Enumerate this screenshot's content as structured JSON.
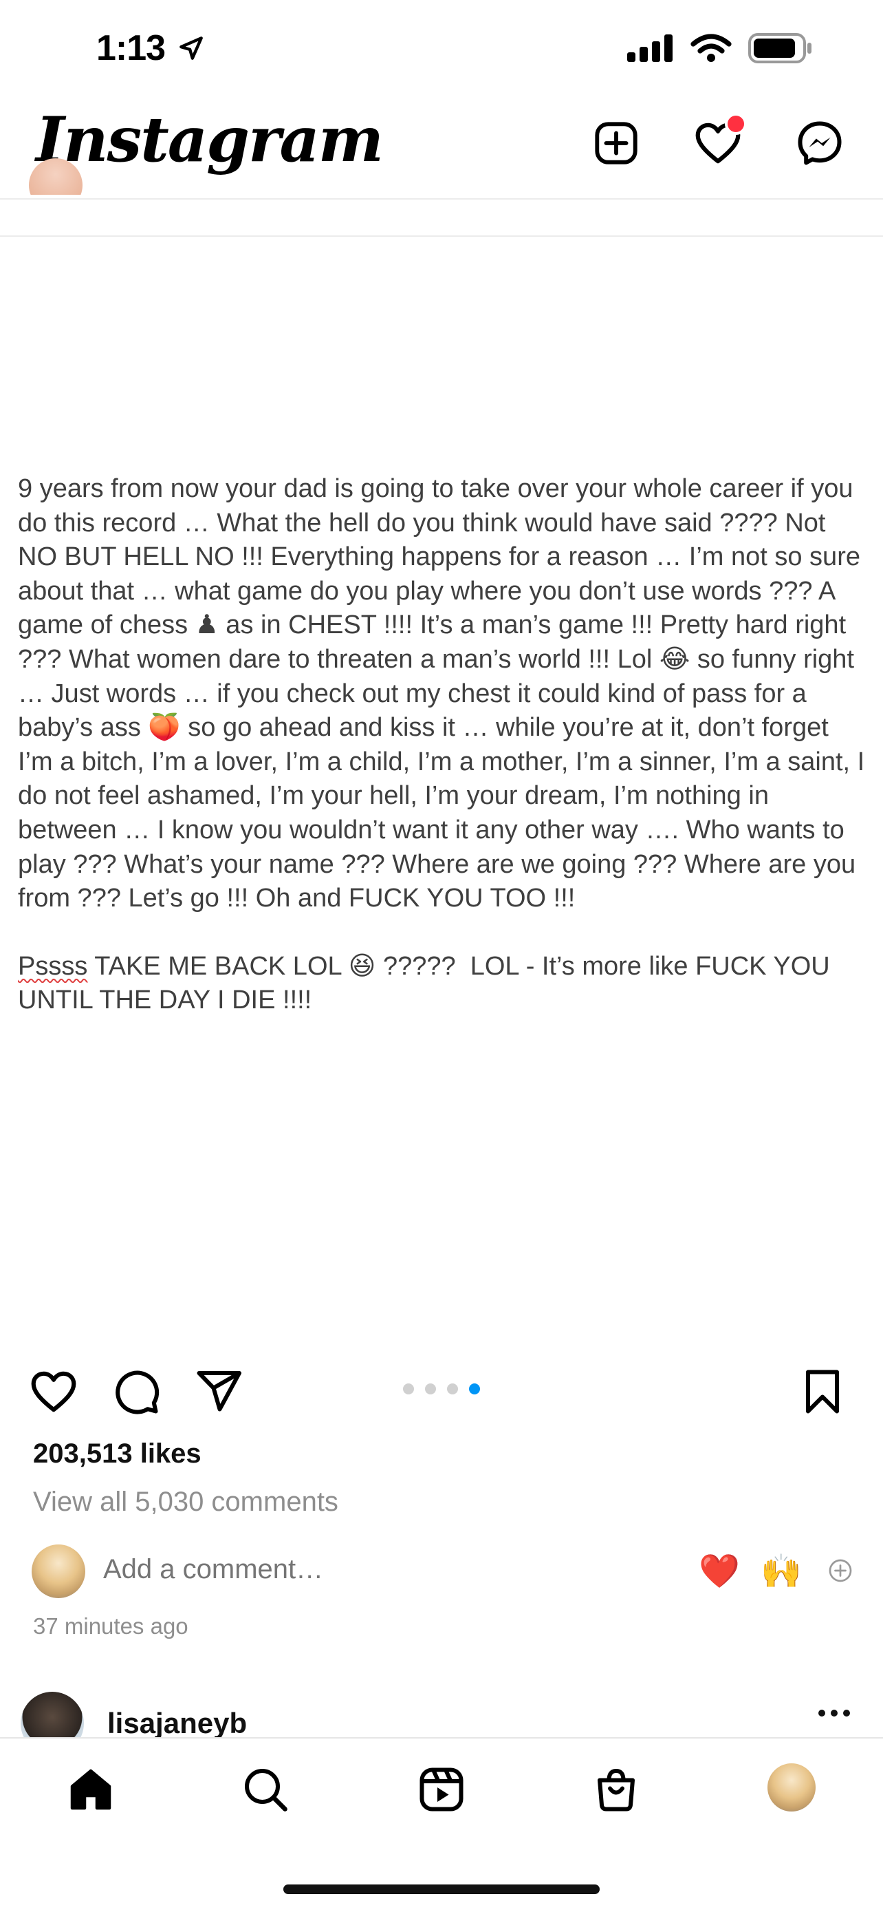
{
  "status_bar": {
    "time": "1:13",
    "icons": [
      "location-arrow-icon",
      "signal-icon",
      "wifi-icon",
      "battery-icon"
    ]
  },
  "header": {
    "logo_text": "Instagram",
    "icons": [
      "new-post-icon",
      "activity-heart-icon",
      "messenger-icon"
    ],
    "notification_dot_color": "#ff3040"
  },
  "post": {
    "caption_paragraphs": [
      "9 years from now your dad is going to take over your whole career if you do this record … What the hell do you think would have said ???? Not NO BUT HELL NO !!! Everything happens for a reason … I’m not so sure about that … what game do you play where you don’t use words ??? A game of chess ♟ as in CHEST !!!! It’s a man’s game !!! Pretty hard right ??? What women dare to threaten a man’s world !!! Lol 😂 so funny right … Just words … if you check out my chest it could kind of pass for a baby’s ass 🍑 so go ahead and kiss it … while you’re at it, don’t forget I’m a bitch, I’m a lover, I’m a child, I’m a mother, I’m a sinner, I’m a saint, I do not feel ashamed, I’m your hell, I’m your dream, I’m nothing in between … I know you wouldn’t want it any other way …. Who wants to play ??? What’s your name ??? Where are we going ??? Where are you from ??? Let’s go !!! Oh and FUCK YOU TOO !!!"
    ],
    "caption_second_first_word": "Pssss",
    "caption_second_rest": " TAKE ME BACK LOL 😆 ?????  LOL - It’s more like FUCK YOU UNTIL THE DAY I DIE !!!!",
    "carousel": {
      "total": 4,
      "active_index": 3,
      "active_color": "#0095f6"
    },
    "likes_text": "203,513 likes",
    "view_comments_text": "View all 5,030 comments",
    "comment_placeholder": "Add a comment…",
    "quick_reactions": [
      "❤️",
      "🙌"
    ],
    "time_ago": "37 minutes ago"
  },
  "next_post": {
    "username": "lisajaneyb"
  },
  "tab_bar": {
    "tabs": [
      "home-icon",
      "search-icon",
      "reels-icon",
      "shop-icon",
      "profile-avatar"
    ]
  }
}
